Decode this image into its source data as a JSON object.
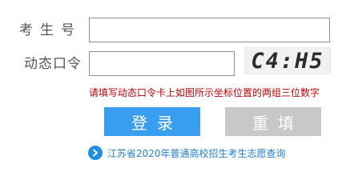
{
  "form": {
    "exam_number_label": "考生号",
    "exam_number_value": "",
    "dynamic_code_label": "动态口令",
    "dynamic_code_value": "",
    "captcha_text": "C4:H5",
    "hint": "请填写动态口令卡上如图所示坐标位置的两组三位数字"
  },
  "buttons": {
    "login_label": "登录",
    "reset_label": "重填"
  },
  "footer": {
    "link_text": "江苏省2020年普通高校招生考生志愿查询",
    "icon": "chevron-right-circle-icon"
  },
  "colors": {
    "login_button": "#3a9ef0",
    "reset_button": "#c8c8c8",
    "hint": "#c00000",
    "link": "#1f7fd0"
  }
}
